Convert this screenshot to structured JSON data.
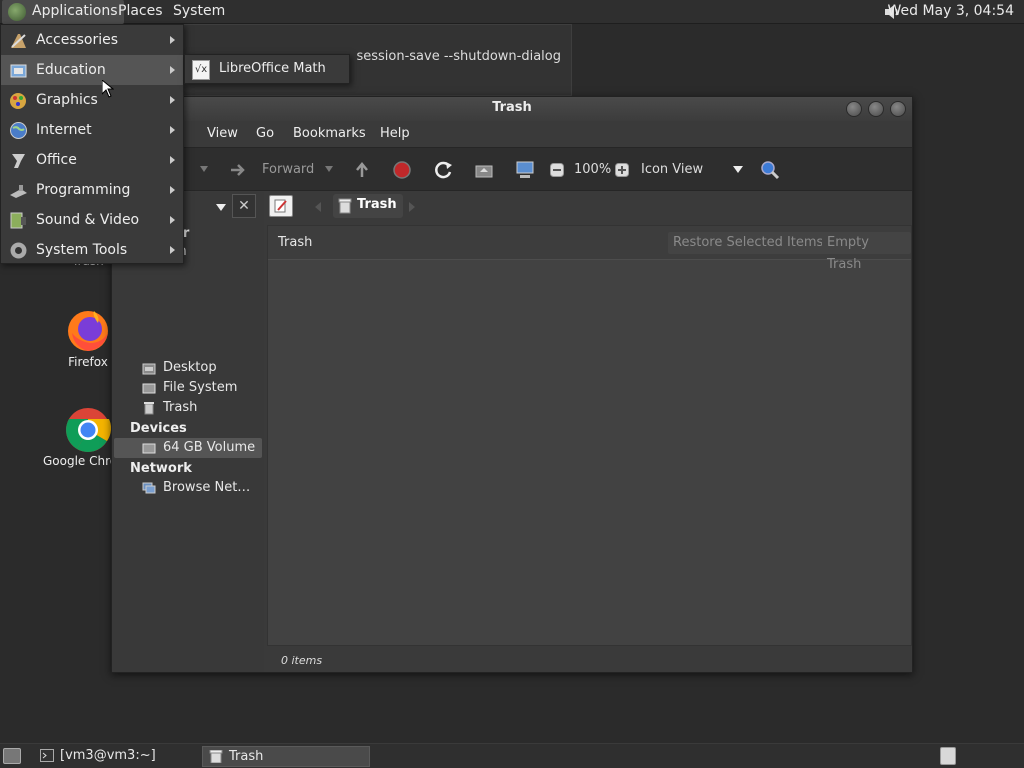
{
  "top_panel": {
    "applications": "Applications",
    "places": "Places",
    "system": "System",
    "clock": "Wed May  3, 04:54"
  },
  "apps_menu": {
    "items": [
      {
        "label": "Accessories",
        "icon": "accessories-icon"
      },
      {
        "label": "Education",
        "icon": "education-icon"
      },
      {
        "label": "Graphics",
        "icon": "graphics-icon"
      },
      {
        "label": "Internet",
        "icon": "internet-icon"
      },
      {
        "label": "Office",
        "icon": "office-icon"
      },
      {
        "label": "Programming",
        "icon": "programming-icon"
      },
      {
        "label": "Sound & Video",
        "icon": "sound-video-icon"
      },
      {
        "label": "System Tools",
        "icon": "system-tools-icon"
      }
    ],
    "education_submenu": {
      "item": "LibreOffice Math",
      "icon_glyph": "√x"
    }
  },
  "terminal": {
    "line1": "session-save --shutdown-dialog",
    "line2": "."
  },
  "desktop": {
    "trash_label": "Trash",
    "firefox_label": "Firefox",
    "chrome_label": "Google Chrome"
  },
  "file_manager": {
    "title": "Trash",
    "menubar": {
      "view": "View",
      "go": "Go",
      "bookmarks": "Bookmarks",
      "help": "Help"
    },
    "toolbar": {
      "forward": "Forward",
      "zoom": "100%",
      "view_mode": "Icon View"
    },
    "side_pane": {
      "partial_section": "er",
      "partial_item": "m",
      "items": [
        {
          "label": "Desktop"
        },
        {
          "label": "File System"
        },
        {
          "label": "Trash"
        }
      ],
      "devices_heading": "Devices",
      "devices": [
        {
          "label": "64 GB Volume"
        }
      ],
      "network_heading": "Network",
      "network": [
        {
          "label": "Browse Net…"
        }
      ]
    },
    "location": {
      "crumb": "Trash"
    },
    "infobar": {
      "title": "Trash",
      "restore": "Restore Selected Items",
      "empty": "Empty Trash"
    },
    "status": "0 items"
  },
  "taskbar": {
    "terminal": "[vm3@vm3:~]",
    "trash": "Trash"
  },
  "colors": {
    "panel": "#2f2f2f",
    "window": "#3a3a3a",
    "content": "#424242",
    "stop_red": "#c0282a",
    "search_blue": "#3d7bd6"
  }
}
